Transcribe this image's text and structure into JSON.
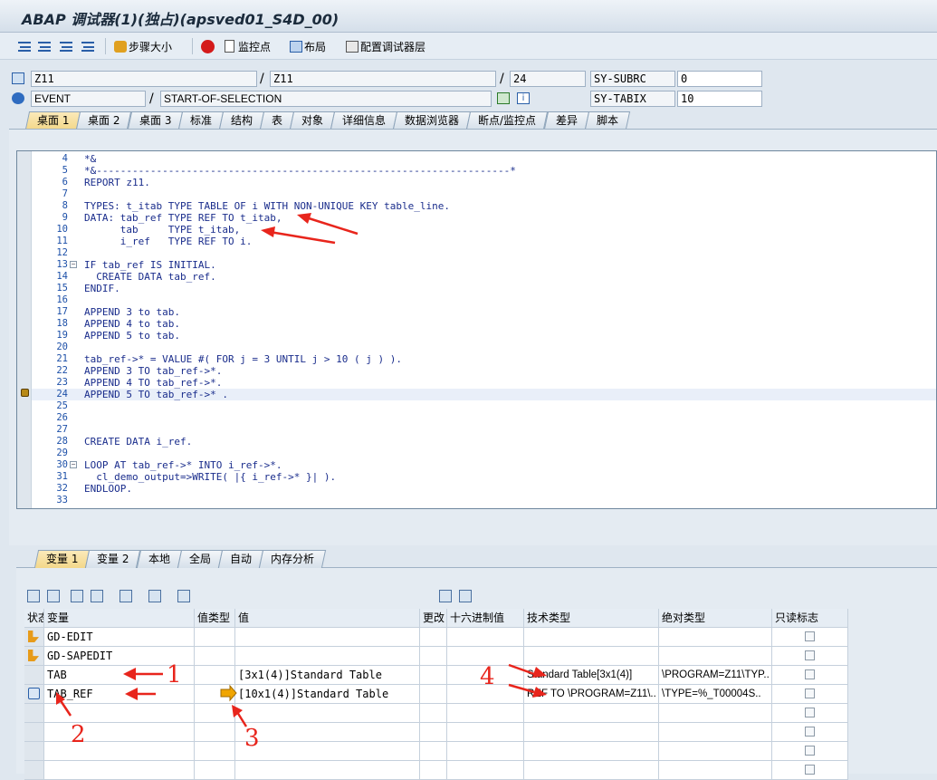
{
  "window": {
    "title": "ABAP 调试器(1)(独占)(apsved01_S4D_00)"
  },
  "toolbar": {
    "step_size": "步骤大小",
    "watchpoint": "监控点",
    "layout": "布局",
    "configure": "配置调试器层"
  },
  "context": {
    "program_1": "Z11",
    "program_2": "Z11",
    "line": "24",
    "event_type": "EVENT",
    "event_name": "START-OF-SELECTION",
    "sy_subrc_label": "SY-SUBRC",
    "sy_subrc_value": "0",
    "sy_tabix_label": "SY-TABIX",
    "sy_tabix_value": "10"
  },
  "main_tabs": [
    "桌面 1",
    "桌面 2",
    "桌面 3",
    "标准",
    "结构",
    "表",
    "对象",
    "详细信息",
    "数据浏览器",
    "断点/监控点",
    "差异",
    "脚本"
  ],
  "code_lines": [
    {
      "n": "4",
      "text": "*&"
    },
    {
      "n": "5",
      "text": "*&---------------------------------------------------------------------*"
    },
    {
      "n": "6",
      "text": "REPORT z11."
    },
    {
      "n": "7",
      "text": ""
    },
    {
      "n": "8",
      "text": "TYPES: t_itab TYPE TABLE OF i WITH NON-UNIQUE KEY table_line."
    },
    {
      "n": "9",
      "text": "DATA: tab_ref TYPE REF TO t_itab,"
    },
    {
      "n": "10",
      "text": "      tab     TYPE t_itab,"
    },
    {
      "n": "11",
      "text": "      i_ref   TYPE REF TO i."
    },
    {
      "n": "12",
      "text": ""
    },
    {
      "n": "13",
      "text": "IF tab_ref IS INITIAL."
    },
    {
      "n": "14",
      "text": "  CREATE DATA tab_ref."
    },
    {
      "n": "15",
      "text": "ENDIF."
    },
    {
      "n": "16",
      "text": ""
    },
    {
      "n": "17",
      "text": "APPEND 3 to tab."
    },
    {
      "n": "18",
      "text": "APPEND 4 to tab."
    },
    {
      "n": "19",
      "text": "APPEND 5 to tab."
    },
    {
      "n": "20",
      "text": ""
    },
    {
      "n": "21",
      "text": "tab_ref->* = VALUE #( FOR j = 3 UNTIL j > 10 ( j ) )."
    },
    {
      "n": "22",
      "text": "APPEND 3 TO tab_ref->*."
    },
    {
      "n": "23",
      "text": "APPEND 4 TO tab_ref->*."
    },
    {
      "n": "24",
      "text": "APPEND 5 TO tab_ref->* ."
    },
    {
      "n": "25",
      "text": ""
    },
    {
      "n": "26",
      "text": ""
    },
    {
      "n": "27",
      "text": ""
    },
    {
      "n": "28",
      "text": "CREATE DATA i_ref."
    },
    {
      "n": "29",
      "text": ""
    },
    {
      "n": "30",
      "text": "LOOP AT tab_ref->* INTO i_ref->*."
    },
    {
      "n": "31",
      "text": "  cl_demo_output=>WRITE( |{ i_ref->* }| )."
    },
    {
      "n": "32",
      "text": "ENDLOOP."
    },
    {
      "n": "33",
      "text": ""
    }
  ],
  "var_tabs": [
    "变量 1",
    "变量 2",
    "本地",
    "全局",
    "自动",
    "内存分析"
  ],
  "grid": {
    "headers": [
      "状态",
      "变量",
      "值类型",
      "值",
      "更改",
      "十六进制值",
      "技术类型",
      "绝对类型",
      "只读标志"
    ],
    "rows": [
      {
        "var": "GD-EDIT",
        "value": "",
        "tech": "",
        "abs": ""
      },
      {
        "var": "GD-SAPEDIT",
        "value": "",
        "tech": "",
        "abs": ""
      },
      {
        "var": "TAB",
        "value": "[3x1(4)]Standard Table",
        "tech": "Standard Table[3x1(4)]",
        "abs": "\\PROGRAM=Z11\\TYP.."
      },
      {
        "var": "TAB_REF",
        "value": "[10x1(4)]Standard Table",
        "tech": "REF TO \\PROGRAM=Z11\\..",
        "abs": "\\TYPE=%_T00004S.."
      },
      {
        "var": "",
        "value": "",
        "tech": "",
        "abs": ""
      },
      {
        "var": "",
        "value": "",
        "tech": "",
        "abs": ""
      },
      {
        "var": "",
        "value": "",
        "tech": "",
        "abs": ""
      },
      {
        "var": "",
        "value": "",
        "tech": "",
        "abs": ""
      }
    ]
  },
  "annotations": {
    "a1": "1",
    "a2": "2",
    "a3": "3",
    "a4": "4"
  },
  "colors": {
    "active_tab": "#f3d88a",
    "annotation": "#e8251c",
    "keyword": "#1a2d8c"
  }
}
